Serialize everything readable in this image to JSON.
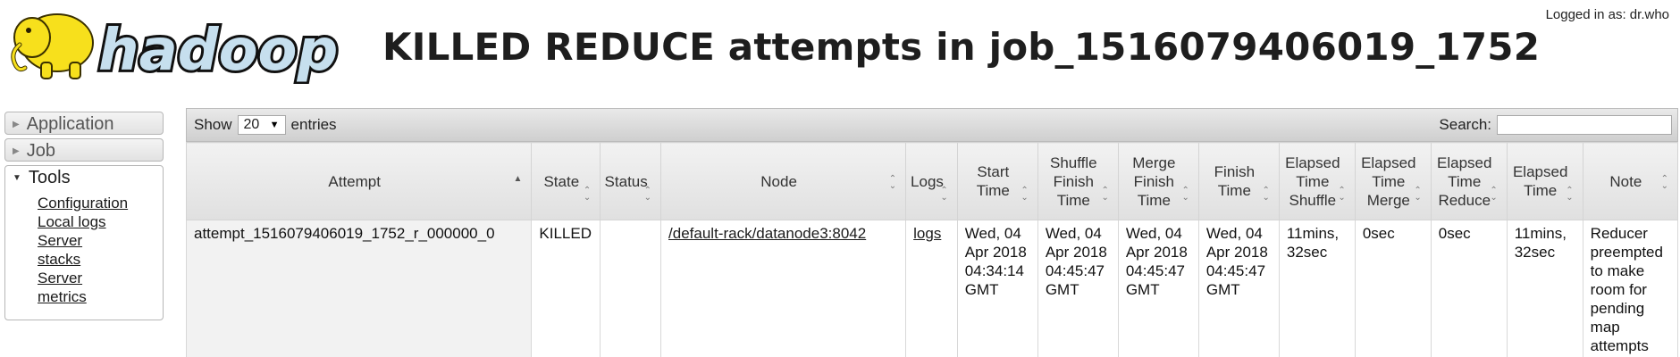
{
  "header": {
    "logo_text": "hadoop",
    "title": "KILLED REDUCE attempts in job_1516079406019_1752",
    "user_label": "Logged in as: dr.who"
  },
  "sidebar": {
    "sections": [
      {
        "label": "Application"
      },
      {
        "label": "Job"
      }
    ],
    "tools": {
      "label": "Tools",
      "items": [
        {
          "label": "Configuration"
        },
        {
          "label": "Local logs"
        },
        {
          "label": "Server"
        },
        {
          "label": "stacks"
        },
        {
          "label": "Server"
        },
        {
          "label": "metrics"
        }
      ]
    }
  },
  "table": {
    "show_label": "Show",
    "page_length": "20",
    "entries_label": "entries",
    "search_label": "Search:",
    "search_value": "",
    "columns": [
      {
        "label": "Attempt"
      },
      {
        "label": "State"
      },
      {
        "label": "Status"
      },
      {
        "label": "Node"
      },
      {
        "label": "Logs"
      },
      {
        "label": "Start Time"
      },
      {
        "label": "Shuffle Finish Time"
      },
      {
        "label": "Merge Finish Time"
      },
      {
        "label": "Finish Time"
      },
      {
        "label": "Elapsed Time Shuffle"
      },
      {
        "label": "Elapsed Time Merge"
      },
      {
        "label": "Elapsed Time Reduce"
      },
      {
        "label": "Elapsed Time"
      },
      {
        "label": "Note"
      }
    ],
    "rows": [
      {
        "attempt": "attempt_1516079406019_1752_r_000000_0",
        "state": "KILLED",
        "status": "",
        "node": "/default-rack/datanode3:8042",
        "logs": "logs",
        "start_time": "Wed, 04 Apr 2018 04:34:14 GMT",
        "shuffle_finish_time": "Wed, 04 Apr 2018 04:45:47 GMT",
        "merge_finish_time": "Wed, 04 Apr 2018 04:45:47 GMT",
        "finish_time": "Wed, 04 Apr 2018 04:45:47 GMT",
        "elapsed_shuffle": "11mins, 32sec",
        "elapsed_merge": "0sec",
        "elapsed_reduce": "0sec",
        "elapsed_time": "11mins, 32sec",
        "note": "Reducer preempted to make room for pending map attempts"
      }
    ]
  }
}
